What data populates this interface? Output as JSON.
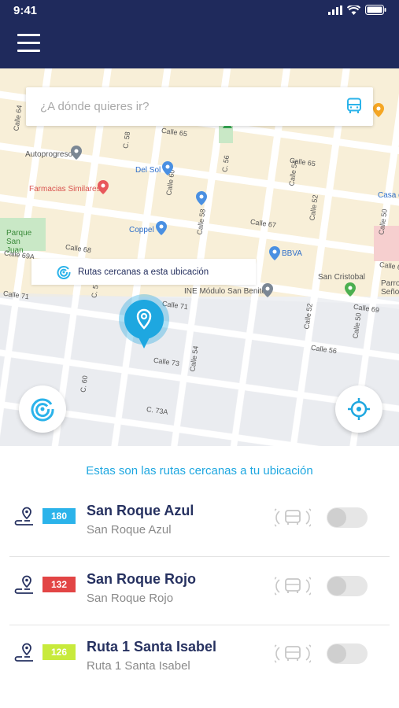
{
  "status": {
    "time": "9:41"
  },
  "search": {
    "placeholder": "¿A dónde quieres ir?"
  },
  "map": {
    "streets": [
      "Calle 64",
      "Calle 65",
      "Calle 65",
      "C. 58",
      "C. 56",
      "Calle 54",
      "Calle 60",
      "Calle 52",
      "Calle 58",
      "Calle 67",
      "Calle 69A",
      "Calle 68",
      "Calle 71",
      "Calle 50",
      "Calle 69",
      "Calle 6",
      "Calle 71",
      "C. 58",
      "Calle 52",
      "Calle 73",
      "C. 60",
      "C. 73A",
      "Calle 50",
      "Calle 54",
      "Calle 56"
    ],
    "places": [
      "Autoprogreso",
      "Del Sol",
      "Farmacias Similares",
      "Coppel",
      "BBVA",
      "INE Módulo San Benito",
      "San Cristobal",
      "Parque San Juan",
      "Casa d",
      "Parroq Seño"
    ]
  },
  "nearby_tag": {
    "label": "Rutas cercanas a esta ubicación"
  },
  "panel": {
    "title": "Estas son las rutas cercanas a tu ubicación"
  },
  "routes": [
    {
      "number": "180",
      "color": "#2bb3ea",
      "name": "San Roque Azul",
      "subtitle": "San Roque Azul",
      "enabled": false
    },
    {
      "number": "132",
      "color": "#e24545",
      "name": "San Roque Rojo",
      "subtitle": "San Roque Rojo",
      "enabled": false
    },
    {
      "number": "126",
      "color": "#c8ea3c",
      "name": "Ruta 1 Santa Isabel",
      "subtitle": "Ruta 1 Santa Isabel",
      "enabled": false
    }
  ],
  "colors": {
    "header": "#1f2a5c",
    "accent": "#1ea7e0",
    "navy": "#263160"
  },
  "icons": [
    "menu-icon",
    "bus-icon",
    "radar-icon",
    "location-pin-icon",
    "crosshair-icon",
    "route-icon",
    "bus-signal-icon"
  ]
}
